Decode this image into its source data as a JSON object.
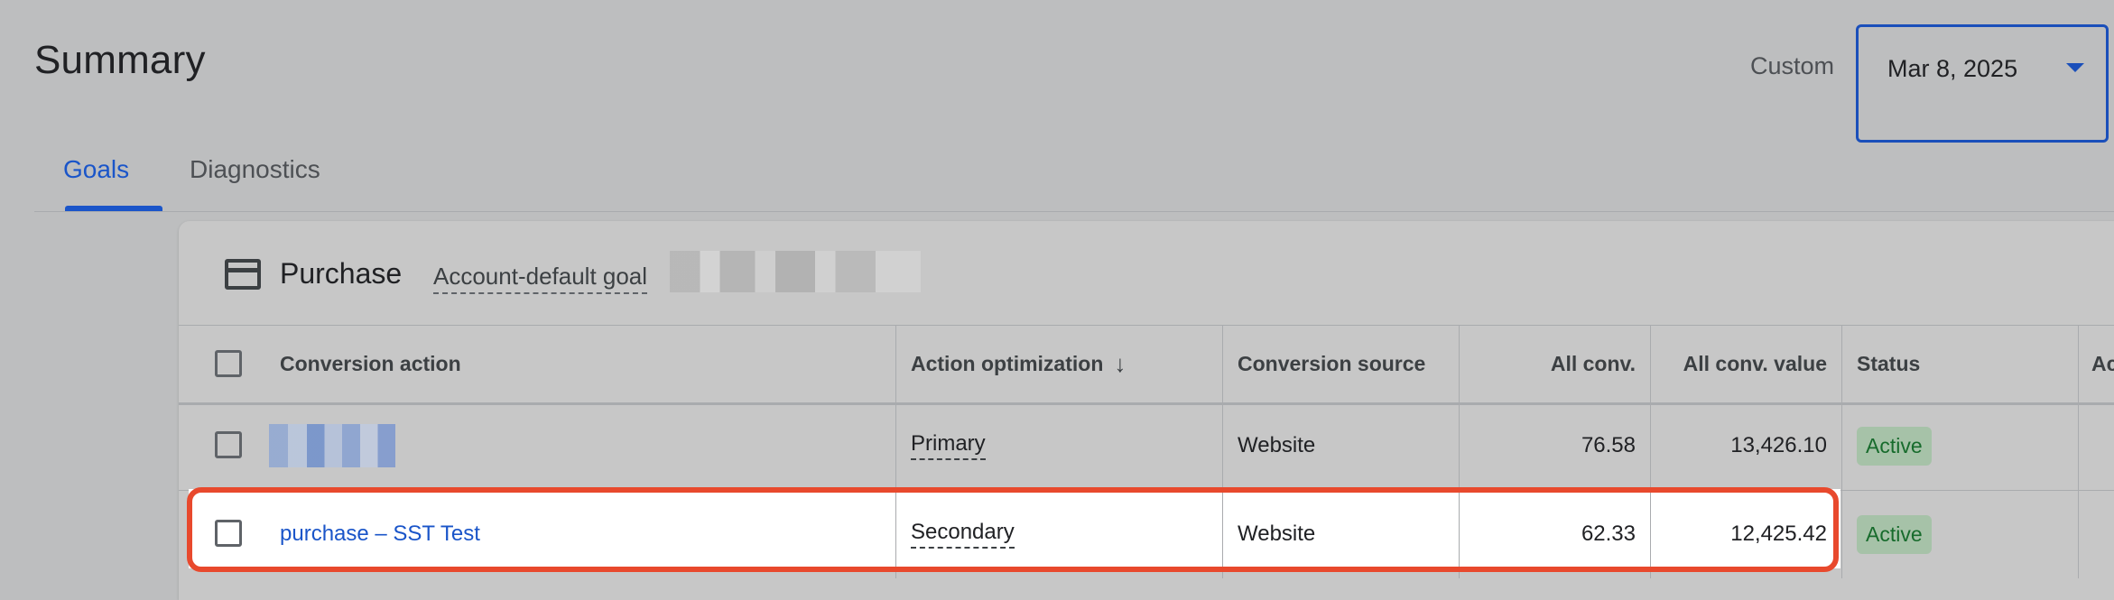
{
  "header": {
    "title": "Summary",
    "range_label": "Custom",
    "date_value": "Mar 8, 2025"
  },
  "tabs": [
    {
      "label": "Goals",
      "active": true
    },
    {
      "label": "Diagnostics",
      "active": false
    }
  ],
  "goal": {
    "name": "Purchase",
    "tag": "Account-default goal"
  },
  "table": {
    "columns": [
      "Conversion action",
      "Action optimization",
      "Conversion source",
      "All conv.",
      "All conv. value",
      "Status",
      "Ac"
    ],
    "sort_column": "Action optimization",
    "rows": [
      {
        "action": "",
        "optimization": "Primary",
        "source": "Website",
        "all_conv": "76.58",
        "all_conv_value": "13,426.10",
        "status": "Active"
      },
      {
        "action": "purchase – SST Test",
        "optimization": "Secondary",
        "source": "Website",
        "all_conv": "62.33",
        "all_conv_value": "12,425.42",
        "status": "Active"
      }
    ]
  },
  "colors": {
    "accent": "#1a55c9",
    "highlight": "#e8492d",
    "status_bg": "#a6c2a8",
    "status_text": "#176b2c"
  }
}
